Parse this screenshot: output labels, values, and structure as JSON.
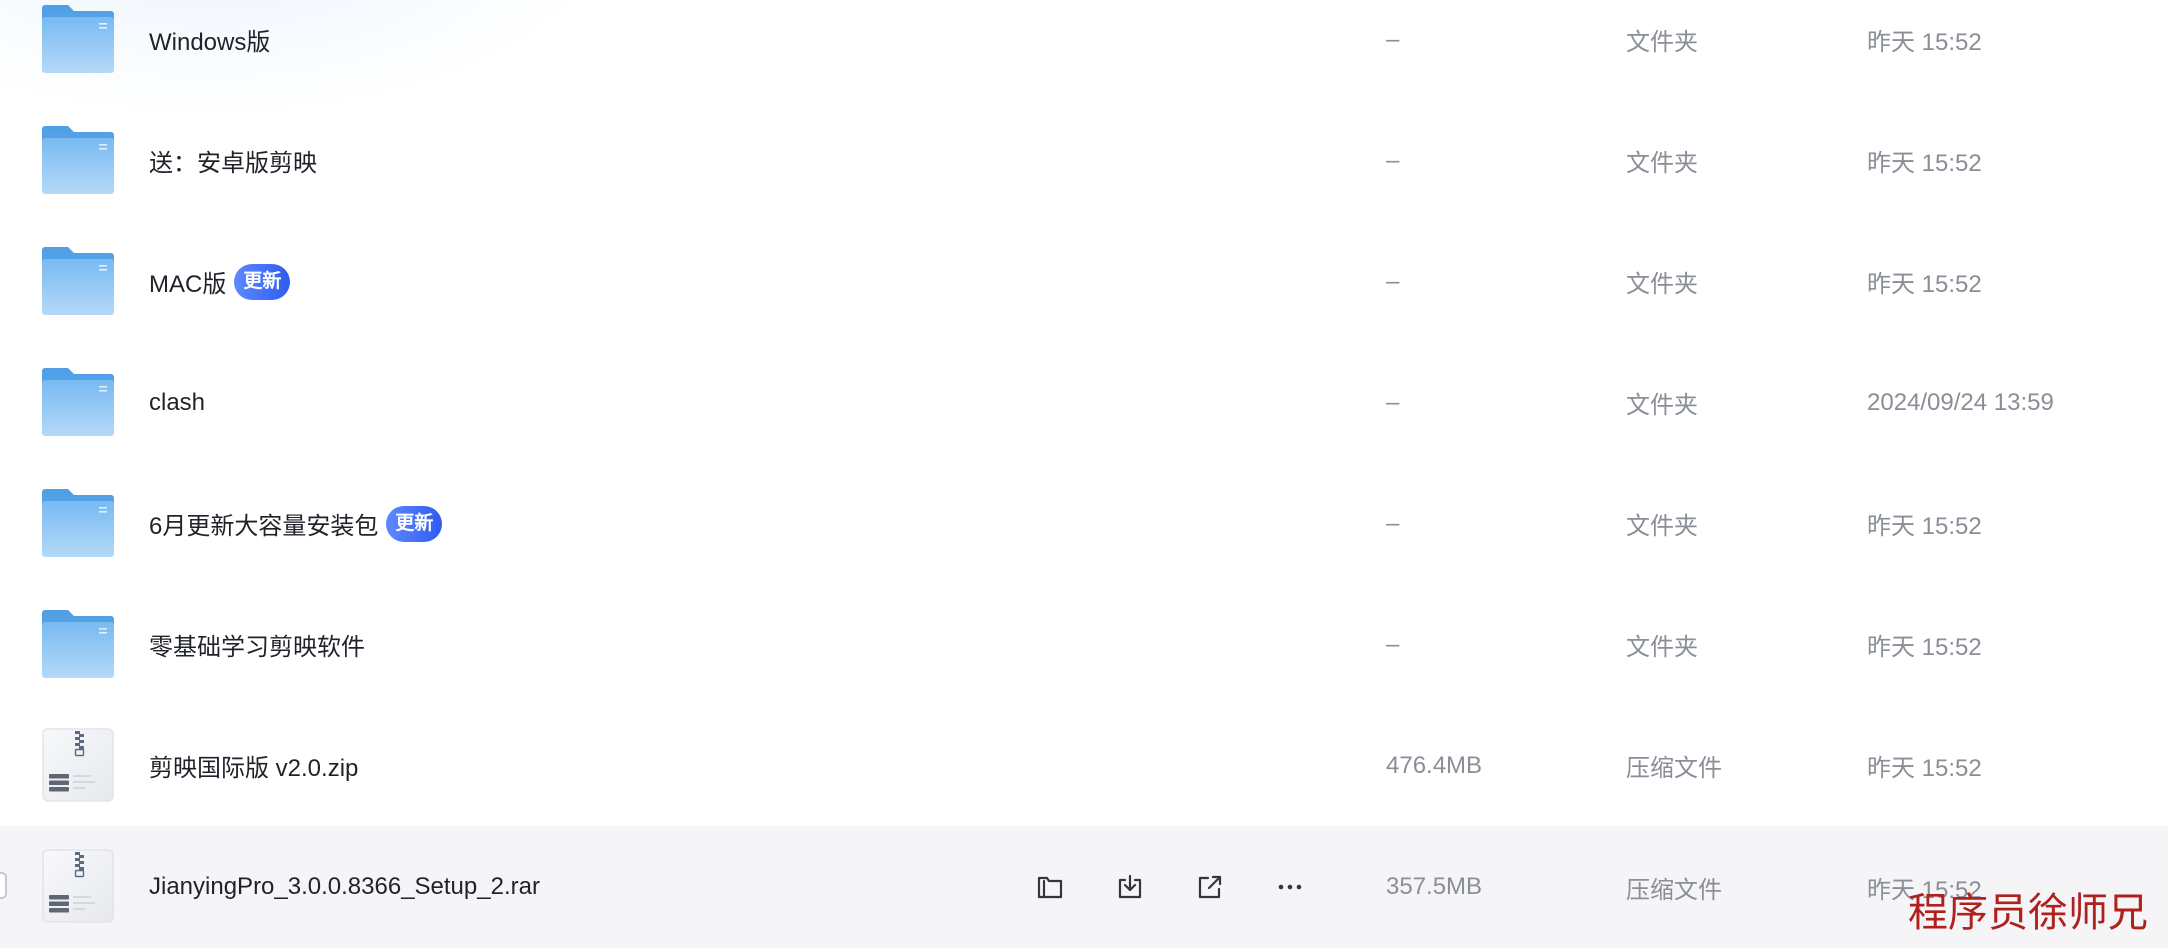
{
  "file_list": {
    "rows": [
      {
        "name": "Windows版",
        "size": "–",
        "type": "文件夹",
        "date": "昨天 15:52",
        "icon": "folder-icon"
      },
      {
        "name": "送：安卓版剪映",
        "size": "–",
        "type": "文件夹",
        "date": "昨天 15:52",
        "icon": "folder-icon"
      },
      {
        "name": "MAC版",
        "badge": "更新",
        "size": "–",
        "type": "文件夹",
        "date": "昨天 15:52",
        "icon": "folder-icon"
      },
      {
        "name": "clash",
        "size": "–",
        "type": "文件夹",
        "date": "2024/09/24 13:59",
        "icon": "folder-icon"
      },
      {
        "name": "6月更新大容量安装包",
        "badge": "更新",
        "size": "–",
        "type": "文件夹",
        "date": "昨天 15:52",
        "icon": "folder-icon"
      },
      {
        "name": "零基础学习剪映软件",
        "size": "–",
        "type": "文件夹",
        "date": "昨天 15:52",
        "icon": "folder-icon"
      },
      {
        "name": "剪映国际版 v2.0.zip",
        "size": "476.4MB",
        "type": "压缩文件",
        "date": "昨天 15:52",
        "icon": "zip-file-icon"
      },
      {
        "name": "JianyingPro_3.0.0.8366_Setup_2.rar",
        "size": "357.5MB",
        "type": "压缩文件",
        "date": "昨天 15:52",
        "icon": "zip-file-icon",
        "hovered": true,
        "actions": [
          "move-icon",
          "download-icon",
          "share-icon",
          "more-icon"
        ]
      }
    ]
  },
  "watermark": "程序员徐师兄",
  "colors": {
    "text_primary": "#1f2329",
    "text_secondary": "#8a8e97",
    "badge_accent": "#2f5cf0",
    "row_hover_bg": "#f5f5f7",
    "folder_blue": "#7cbcf2",
    "watermark": "#b0201c"
  }
}
